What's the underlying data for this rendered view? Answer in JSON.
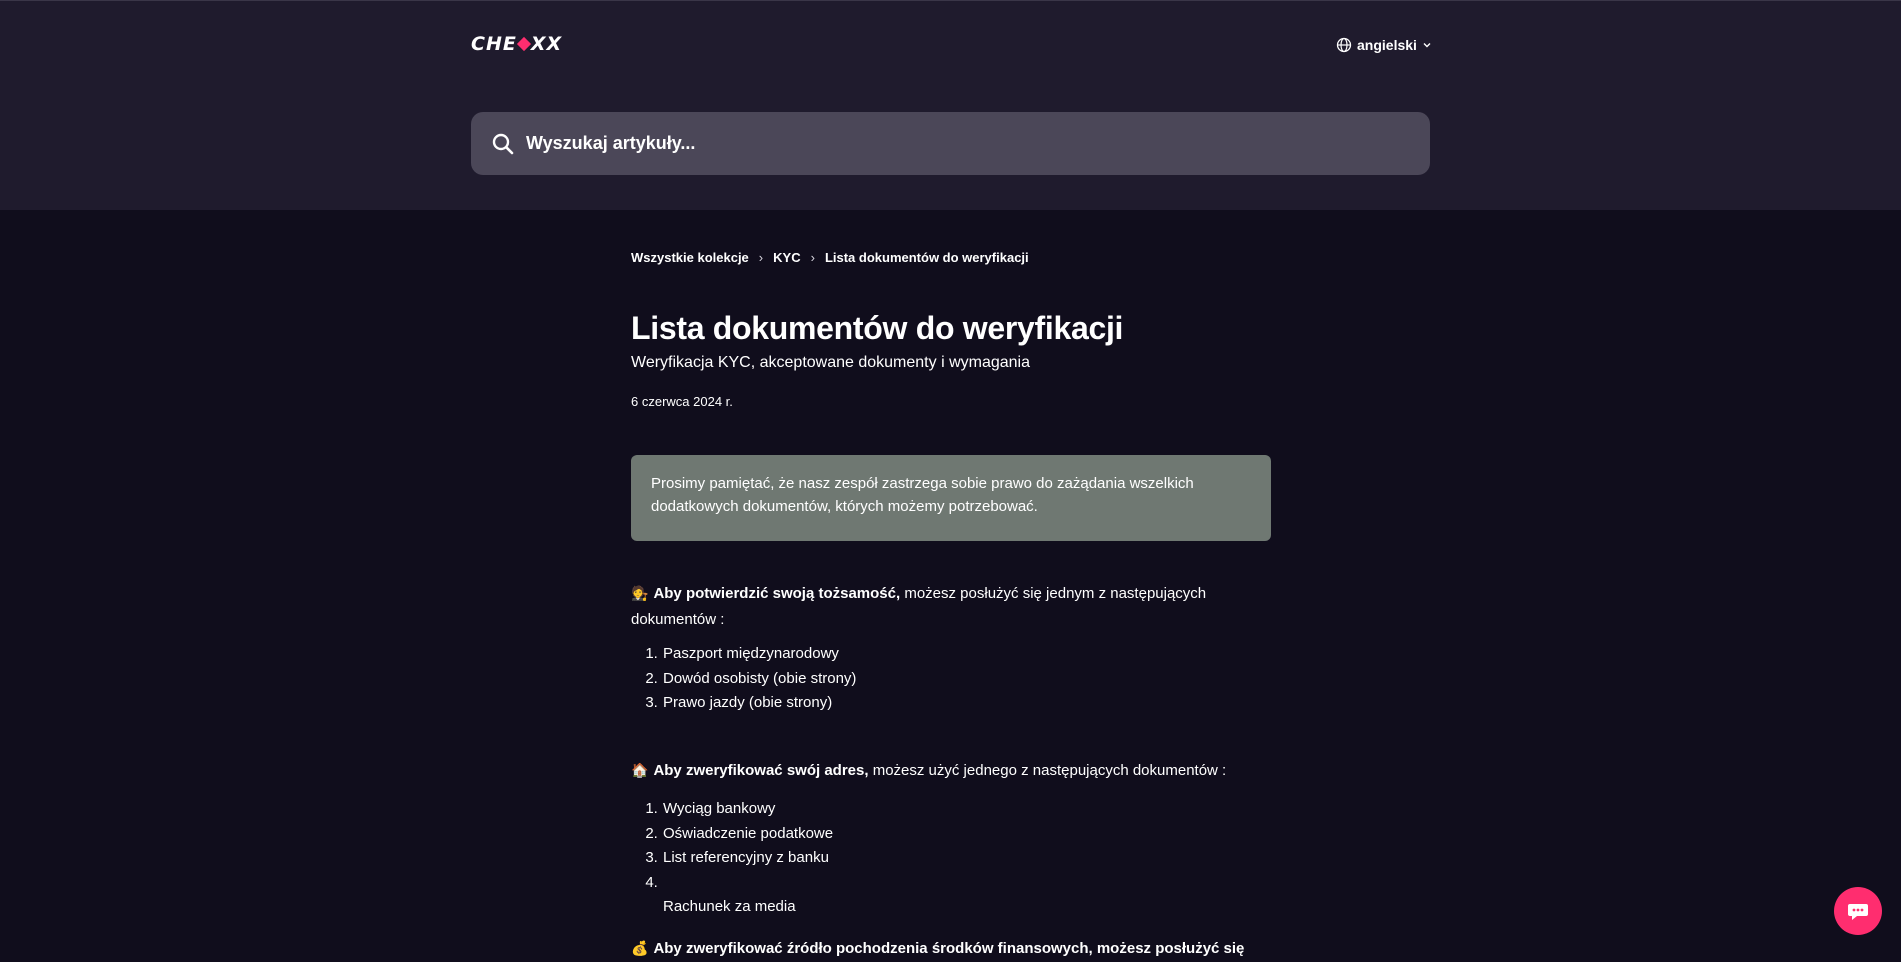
{
  "header": {
    "logo_text_left": "CHE",
    "logo_text_right": "X",
    "language": "angielski",
    "search_placeholder": "Wyszukaj artykuły..."
  },
  "breadcrumb": {
    "items": [
      "Wszystkie kolekcje",
      "KYC",
      "Lista dokumentów do weryfikacji"
    ],
    "separator": "›"
  },
  "article": {
    "title": "Lista dokumentów do weryfikacji",
    "subtitle": "Weryfikacja KYC, akceptowane dokumenty i wymagania",
    "date": "6 czerwca 2024 r.",
    "notice": "Prosimy pamiętać, że nasz zespół zastrzega sobie prawo do zażądania wszelkich dodatkowych dokumentów, których możemy potrzebować.",
    "identity": {
      "emoji": "🧑‍⚖️",
      "bold": "Aby potwierdzić swoją tożsamość,",
      "rest": " możesz posłużyć się jednym z następujących dokumentów :",
      "items": [
        "Paszport międzynarodowy",
        "Dowód osobisty (obie strony)",
        "Prawo jazdy (obie strony)"
      ]
    },
    "address": {
      "emoji": "🏠",
      "bold": "Aby  zweryfikować swój adres,",
      "rest": " możesz użyć jednego z następujących dokumentów :",
      "items": [
        "Wyciąg bankowy",
        "Oświadczenie podatkowe",
        "List referencyjny z banku",
        "",
        "Rachunek za media"
      ]
    },
    "funds": {
      "emoji": "💰",
      "text": "Aby zweryfikować źródło pochodzenia środków finansowych, możesz posłużyć się"
    }
  },
  "colors": {
    "page_bg": "#100d1c",
    "header_bg": "#1f1b2d",
    "search_bg": "#4b4758",
    "notice_bg": "#6f7872",
    "accent": "#ff2d6f"
  },
  "icons": [
    "globe-icon",
    "chevron-down-icon",
    "search-icon",
    "chat-icon"
  ]
}
